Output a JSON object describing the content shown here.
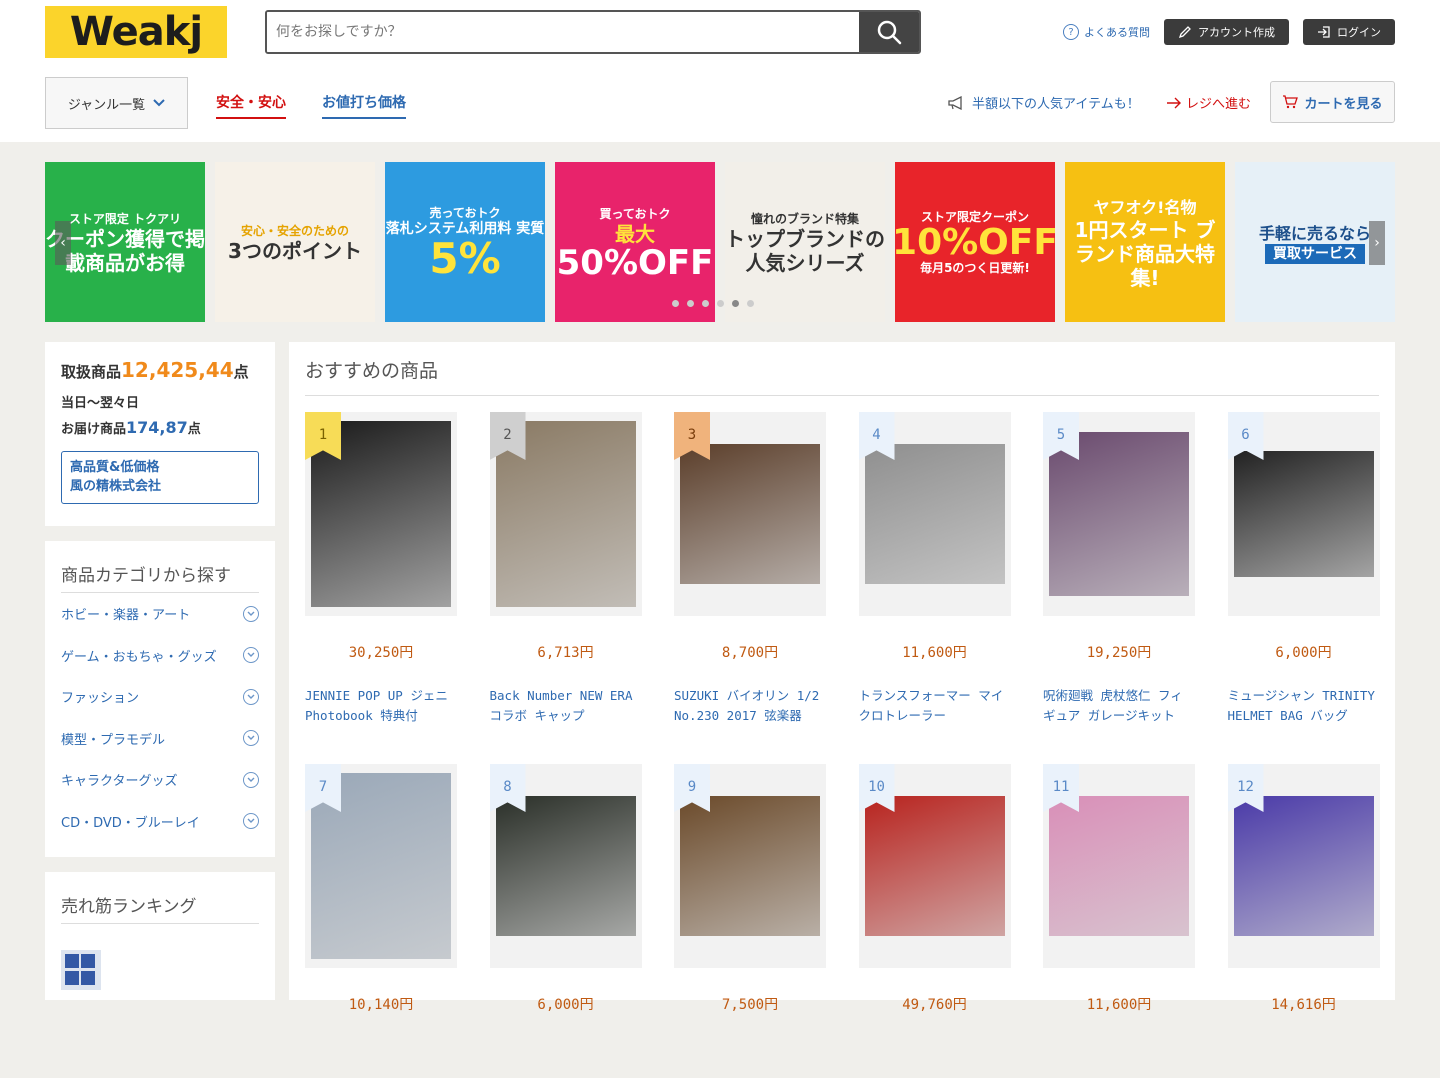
{
  "header": {
    "logo": "Weakj",
    "search_placeholder": "何をお探しですか？",
    "faq": "よくある質問",
    "create_account": "アカウント作成",
    "login": "ログイン",
    "genre": "ジャンル一覧",
    "tab_safe": "安全・安心",
    "tab_deal": "お値打ち価格",
    "promo": "半額以下の人気アイテムも！",
    "register": "レジへ進む",
    "cart": "カートを見る"
  },
  "banners": [
    {
      "l1": "ストア限定 トクアリ",
      "l2": "クーポン獲得で掲載商品がお得",
      "l3": ""
    },
    {
      "l1": "安心・安全のための",
      "l2": "3つのポイント",
      "l3": ""
    },
    {
      "l1": "売っておトク",
      "l2": "落札システム利用料 実質",
      "l3": "5%"
    },
    {
      "l1": "買っておトク",
      "l2": "最大",
      "l3": "50%OFF"
    },
    {
      "l1": "憧れのブランド特集",
      "l2": "トップブランドの人気シリーズ",
      "l3": ""
    },
    {
      "l1": "ストア限定クーポン",
      "l2": "毎月5のつく日更新!",
      "l3": "10%OFF"
    },
    {
      "l1": "ヤフオク!名物",
      "l2": "1円スタート ブランド商品大特集!",
      "l3": ""
    },
    {
      "l1": "手軽に売るなら",
      "l2": "買取サービス",
      "l3": ""
    }
  ],
  "stats": {
    "label_total": "取扱商品",
    "total": "12,425,44",
    "unit": "点",
    "delivery_line1": "当日〜翌々日",
    "delivery_line2": "お届け商品",
    "delivery_count": "174,87",
    "company_line1": "高品質&低価格",
    "company_line2": "風の精株式会社"
  },
  "categories": {
    "title": "商品カテゴリから探す",
    "items": [
      "ホビー・楽器・アート",
      "ゲーム・おもちゃ・グッズ",
      "ファッション",
      "模型・プラモデル",
      "キャラクターグッズ",
      "CD・DVD・ブルーレイ"
    ]
  },
  "ranking": {
    "title": "売れ筋ランキング"
  },
  "main": {
    "title": "おすすめの商品",
    "products": [
      {
        "rank": "1",
        "price": "30,250円",
        "name": "JENNIE POP UP ジェニ Photobook 特典付",
        "color": "#1a1a1a",
        "h": 186
      },
      {
        "rank": "2",
        "price": "6,713円",
        "name": "Back Number NEW ERAコラボ キャップ",
        "color": "#8a7a64",
        "h": 186
      },
      {
        "rank": "3",
        "price": "8,700円",
        "name": "SUZUKI バイオリン 1/2 No.230 2017 弦楽器",
        "color": "#5b3e2a",
        "h": 140
      },
      {
        "rank": "4",
        "price": "11,600円",
        "name": "トランスフォーマー マイクロトレーラー",
        "color": "#8f8f8f",
        "h": 140
      },
      {
        "rank": "5",
        "price": "19,250円",
        "name": "呪術廻戦 虎杖悠仁 フィギュア ガレージキット",
        "color": "#6a4a6e",
        "h": 164
      },
      {
        "rank": "6",
        "price": "6,000円",
        "name": "ミュージシャン TRINITY HELMET BAG バッグ",
        "color": "#222222",
        "h": 126
      },
      {
        "rank": "7",
        "price": "10,140円",
        "name": "",
        "color": "#9aa8b8",
        "h": 186
      },
      {
        "rank": "8",
        "price": "6,000円",
        "name": "",
        "color": "#2a2f28",
        "h": 140
      },
      {
        "rank": "9",
        "price": "7,500円",
        "name": "",
        "color": "#6b4a2a",
        "h": 140
      },
      {
        "rank": "10",
        "price": "49,760円",
        "name": "",
        "color": "#b8231e",
        "h": 140
      },
      {
        "rank": "11",
        "price": "11,600円",
        "name": "",
        "color": "#d98fb8",
        "h": 140
      },
      {
        "rank": "12",
        "price": "14,616円",
        "name": "",
        "color": "#4a3aa8",
        "h": 140
      }
    ]
  }
}
